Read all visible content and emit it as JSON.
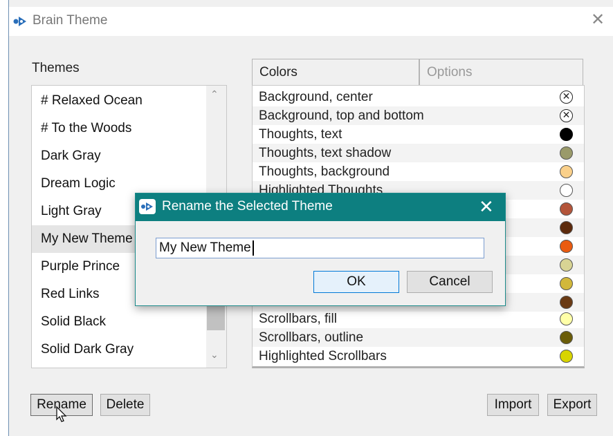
{
  "window": {
    "title": "Brain Theme",
    "close_icon": "close-icon"
  },
  "themes": {
    "label": "Themes",
    "items": [
      "# Relaxed Ocean",
      "# To the Woods",
      "Dark Gray",
      "Dream Logic",
      "Light Gray",
      "My New Theme",
      "Purple Prince",
      "Red Links",
      "Solid Black",
      "Solid Dark Gray"
    ],
    "selected": "My New Theme"
  },
  "tabs": [
    "Colors",
    "Options"
  ],
  "colors": [
    {
      "label": "Background, center",
      "color": "none"
    },
    {
      "label": "Background, top and bottom",
      "color": "none"
    },
    {
      "label": "Thoughts, text",
      "color": "#000000"
    },
    {
      "label": "Thoughts, text shadow",
      "color": "#9a9a6a"
    },
    {
      "label": "Thoughts, background",
      "color": "#fad08a"
    },
    {
      "label": "Highlighted Thoughts",
      "color": "#ffffff"
    },
    {
      "label": "",
      "color": "#b4553a"
    },
    {
      "label": "",
      "color": "#5c2a0c"
    },
    {
      "label": "",
      "color": "#ea5b10"
    },
    {
      "label": "",
      "color": "#d8d494"
    },
    {
      "label": "",
      "color": "#d2b83a"
    },
    {
      "label": "",
      "color": "#6a3a14"
    },
    {
      "label": "Scrollbars, fill",
      "color": "#ffffa8"
    },
    {
      "label": "Scrollbars, outline",
      "color": "#6a5c08"
    },
    {
      "label": "Highlighted Scrollbars",
      "color": "#d8d400"
    }
  ],
  "buttons": {
    "rename": "Rename",
    "delete": "Delete",
    "import": "Import",
    "export": "Export"
  },
  "dialog": {
    "title": "Rename the Selected Theme",
    "input_value": "My New Theme",
    "ok": "OK",
    "cancel": "Cancel"
  }
}
